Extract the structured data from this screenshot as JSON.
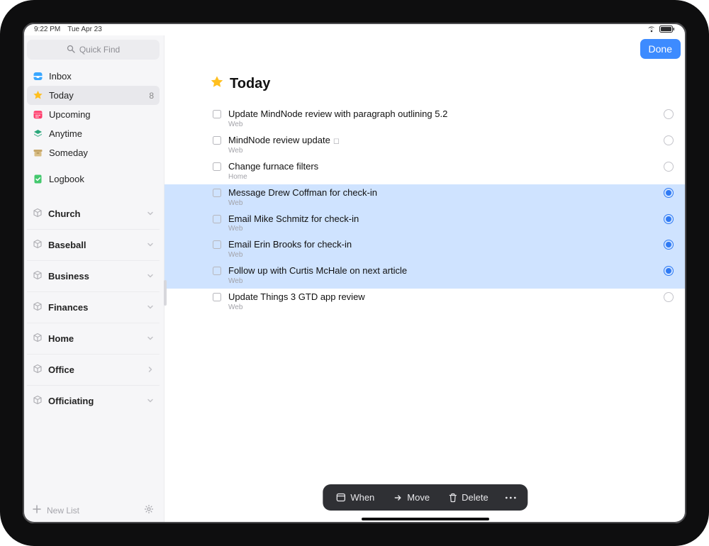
{
  "statusbar": {
    "time": "9:22 PM",
    "date": "Tue Apr 23"
  },
  "header": {
    "done_label": "Done"
  },
  "search": {
    "placeholder": "Quick Find"
  },
  "sidebar": {
    "nav": [
      {
        "id": "inbox",
        "label": "Inbox",
        "selected": false,
        "count": ""
      },
      {
        "id": "today",
        "label": "Today",
        "selected": true,
        "count": "8"
      },
      {
        "id": "upcoming",
        "label": "Upcoming",
        "selected": false,
        "count": ""
      },
      {
        "id": "anytime",
        "label": "Anytime",
        "selected": false,
        "count": ""
      },
      {
        "id": "someday",
        "label": "Someday",
        "selected": false,
        "count": ""
      },
      {
        "id": "logbook",
        "label": "Logbook",
        "selected": false,
        "count": ""
      }
    ],
    "areas": [
      {
        "label": "Church",
        "chevron": "down"
      },
      {
        "label": "Baseball",
        "chevron": "down"
      },
      {
        "label": "Business",
        "chevron": "down"
      },
      {
        "label": "Finances",
        "chevron": "down"
      },
      {
        "label": "Home",
        "chevron": "down"
      },
      {
        "label": "Office",
        "chevron": "right"
      },
      {
        "label": "Officiating",
        "chevron": "down"
      }
    ],
    "new_list_label": "New List"
  },
  "page": {
    "title": "Today"
  },
  "tasks": [
    {
      "title": "Update MindNode review with paragraph outlining 5.2",
      "tag": "Web",
      "selected": false,
      "radio_on": false,
      "attachment": false
    },
    {
      "title": "MindNode review update",
      "tag": "Web",
      "selected": false,
      "radio_on": false,
      "attachment": true
    },
    {
      "title": "Change furnace filters",
      "tag": "Home",
      "selected": false,
      "radio_on": false,
      "attachment": false
    },
    {
      "title": "Message Drew Coffman for check-in",
      "tag": "Web",
      "selected": true,
      "radio_on": true,
      "attachment": false
    },
    {
      "title": "Email Mike Schmitz for check-in",
      "tag": "Web",
      "selected": true,
      "radio_on": true,
      "attachment": false
    },
    {
      "title": "Email Erin Brooks for check-in",
      "tag": "Web",
      "selected": true,
      "radio_on": true,
      "attachment": false
    },
    {
      "title": "Follow up with Curtis McHale on next article",
      "tag": "Web",
      "selected": true,
      "radio_on": true,
      "attachment": false
    },
    {
      "title": "Update Things 3 GTD app review",
      "tag": "Web",
      "selected": false,
      "radio_on": false,
      "attachment": false
    }
  ],
  "toolbar": {
    "when_label": "When",
    "move_label": "Move",
    "delete_label": "Delete"
  }
}
